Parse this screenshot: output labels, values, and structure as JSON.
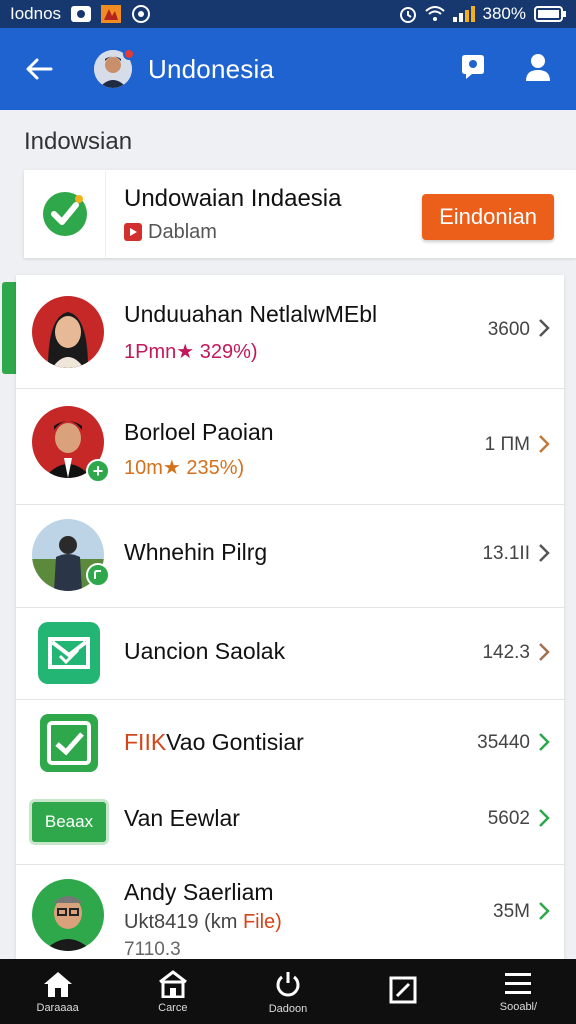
{
  "status_bar": {
    "carrier": "Iodnos",
    "battery": "380%",
    "icons": [
      "eye-icon",
      "app-icon",
      "vpn-icon",
      "alarm-icon",
      "wifi-icon",
      "signal-icon",
      "battery-icon"
    ]
  },
  "app_bar": {
    "title": "Undonesia",
    "icons": [
      "back-arrow-icon",
      "avatar",
      "chat-icon",
      "profile-icon"
    ]
  },
  "section": {
    "title": "Indowsian"
  },
  "featured": {
    "name": "Undowaian Indaesia",
    "subtitle": "Dablam",
    "button_label": "Eindonian",
    "colors": {
      "button": "#ec5f1a",
      "logo": "#2ea84a"
    }
  },
  "list": {
    "rows": [
      {
        "name": "Unduuahan NetlalwMEbl",
        "meta": "1Pmn★ 329%)",
        "value": "3600"
      },
      {
        "name": "Borloel Paoian",
        "meta": "10m★ 235%)",
        "value": "1 ΠM"
      },
      {
        "name": "Whnehin Pilrg",
        "meta": "",
        "value": "13.1ΙΙ"
      },
      {
        "name": "Uancion Saolak",
        "meta": "",
        "value": "142.3"
      },
      {
        "name_prefix": "FIIK",
        "name": "Vao Gontisiar",
        "meta": "",
        "value": "35440"
      },
      {
        "badge": "Beaax",
        "name": "Van Eewlar",
        "meta": "",
        "value": "5602"
      },
      {
        "name": "Andy Saerliam",
        "meta_prefix": "Ukt8419 (km",
        "meta_suffix": "File)",
        "extra": "7110.3",
        "value": "35M"
      }
    ]
  },
  "bottom_nav": {
    "items": [
      {
        "label": "Daraaaa",
        "icon": "home-icon"
      },
      {
        "label": "Carce",
        "icon": "store-icon"
      },
      {
        "label": "Dadoon",
        "icon": "power-icon"
      },
      {
        "label": "",
        "icon": "edit-icon"
      },
      {
        "label": "Sooabl/",
        "icon": "menu-icon"
      }
    ]
  }
}
